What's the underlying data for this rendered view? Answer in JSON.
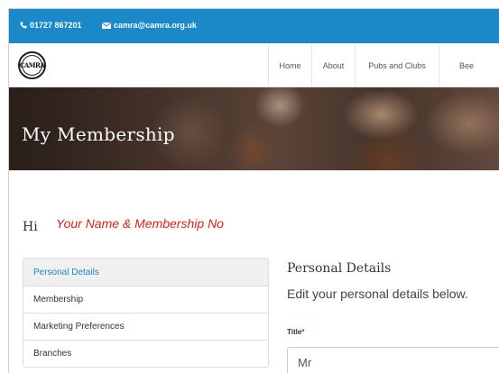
{
  "topbar": {
    "phone": "01727 867201",
    "email": "camra@camra.org.uk"
  },
  "logo": {
    "text": "CAMRA"
  },
  "nav": {
    "items": [
      {
        "label": "Home"
      },
      {
        "label": "About"
      },
      {
        "label": "Pubs and Clubs"
      },
      {
        "label": "Bee"
      }
    ]
  },
  "hero": {
    "title": "My Membership"
  },
  "greeting": {
    "prefix": "Hi",
    "note": "Your Name & Membership No"
  },
  "sidebar": {
    "items": [
      {
        "label": "Personal Details",
        "active": true
      },
      {
        "label": "Membership"
      },
      {
        "label": "Marketing Preferences"
      },
      {
        "label": "Branches"
      }
    ]
  },
  "section": {
    "title": "Personal Details",
    "description": "Edit your personal details below."
  },
  "form": {
    "title_label": "Title",
    "required_mark": "*",
    "title_value": "Mr"
  },
  "colors": {
    "brand_blue": "#1a88c9",
    "annotation_red": "#e41c1c"
  }
}
